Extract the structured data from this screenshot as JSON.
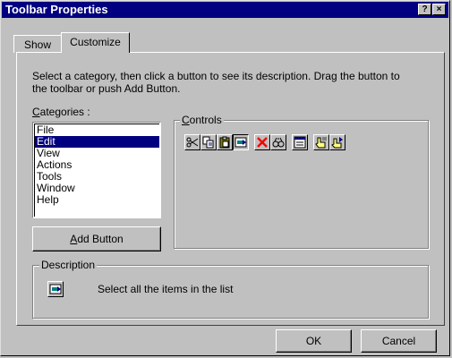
{
  "window": {
    "title": "Toolbar Properties",
    "help_label": "?",
    "close_label": "×"
  },
  "tabs": [
    {
      "label": "Show"
    },
    {
      "label": "Customize"
    }
  ],
  "instructions": "Select a category, then click a button to see its description. Drag the button to the toolbar or push Add Button.",
  "categories": {
    "label_first": "C",
    "label_rest": "ategories :",
    "items": [
      "File",
      "Edit",
      "View",
      "Actions",
      "Tools",
      "Window",
      "Help"
    ],
    "selected": "Edit"
  },
  "controls": {
    "label_first": "C",
    "label_rest": "ontrols",
    "tools": [
      "cut-icon",
      "copy-icon",
      "paste-icon",
      "select-all-icon",
      "delete-icon",
      "find-icon",
      "properties-icon",
      "hand-icon",
      "hand-arrow-icon"
    ]
  },
  "add_button": {
    "label_first": "A",
    "label_rest": "dd Button"
  },
  "description": {
    "legend": "Description",
    "icon": "select-all-icon",
    "text": "Select all the items in the list"
  },
  "footer": {
    "ok_label": "OK",
    "cancel_label": "Cancel"
  },
  "colors": {
    "titlebar": "#000080",
    "face": "#c0c0c0",
    "selection": "#000080",
    "delete": "#ff0000"
  }
}
